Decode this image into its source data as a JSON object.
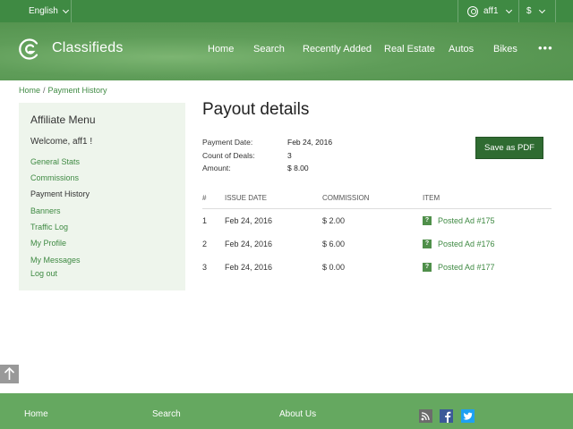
{
  "topbar": {
    "language": "English",
    "username": "aff1",
    "currency": "$"
  },
  "header": {
    "brand": "Classifieds",
    "nav": [
      "Home",
      "Search",
      "Recently Added",
      "Real Estate",
      "Autos",
      "Bikes"
    ],
    "more": "•••"
  },
  "breadcrumb": {
    "home": "Home",
    "separator": "/",
    "current": "Payment History"
  },
  "sidebar": {
    "title": "Affiliate Menu",
    "welcome": "Welcome, aff1 !",
    "links": [
      "General Stats",
      "Commissions",
      "Payment History",
      "Banners",
      "Traffic Log",
      "My Profile",
      "My Messages",
      "Log out"
    ]
  },
  "main": {
    "title": "Payout details",
    "payment_date_label": "Payment Date:",
    "payment_date": "Feb 24, 2016",
    "count_label": "Count of Deals:",
    "count": "3",
    "amount_label": "Amount:",
    "amount": "$ 8.00",
    "save_pdf": "Save as PDF",
    "columns": [
      "#",
      "ISSUE DATE",
      "COMMISSION",
      "ITEM"
    ],
    "rows": [
      {
        "num": "1",
        "date": "Feb 24, 2016",
        "commission": "$ 2.00",
        "item": "Posted Ad #175",
        "icon": "?"
      },
      {
        "num": "2",
        "date": "Feb 24, 2016",
        "commission": "$ 6.00",
        "item": "Posted Ad #176",
        "icon": "?"
      },
      {
        "num": "3",
        "date": "Feb 24, 2016",
        "commission": "$ 0.00",
        "item": "Posted Ad #177",
        "icon": "?"
      }
    ]
  },
  "footer": {
    "links": [
      "Home",
      "Search",
      "About Us"
    ]
  },
  "colors": {
    "primary_green": "#3f8a43",
    "button_green": "#2f6b31",
    "sidebar_bg": "#eef5ec",
    "footer_green": "#65a860"
  },
  "icons": {
    "rss": "rss-icon",
    "facebook": "facebook-icon",
    "twitter": "twitter-icon"
  }
}
